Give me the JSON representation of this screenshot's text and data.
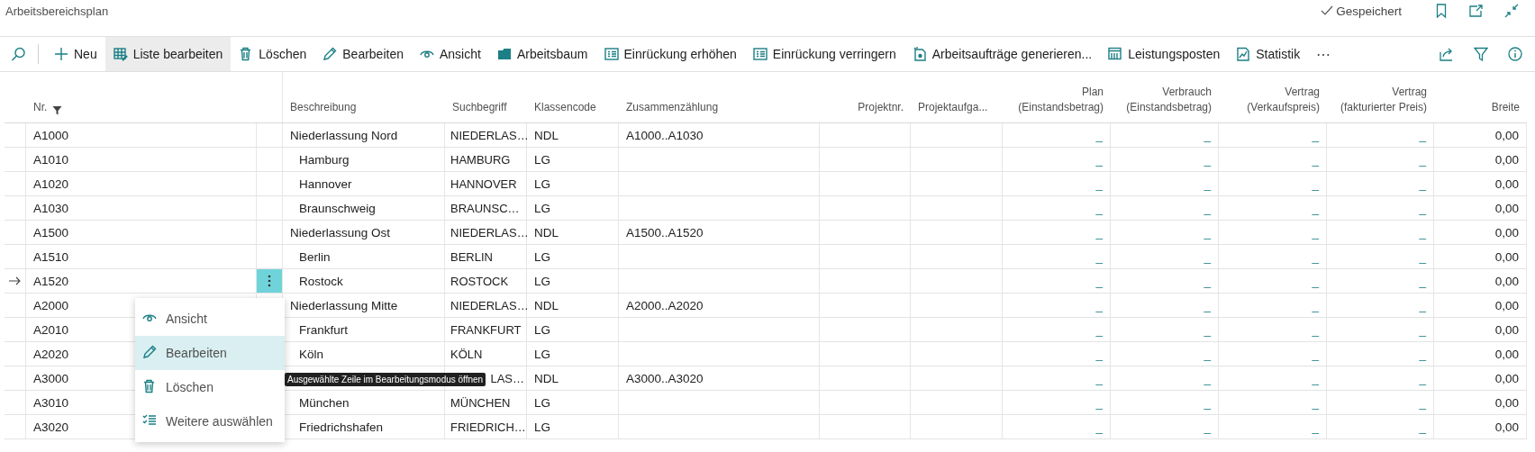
{
  "window": {
    "title": "Arbeitsbereichsplan",
    "save_status": "Gespeichert"
  },
  "toolbar": {
    "items": [
      {
        "label": "Neu",
        "selected": false
      },
      {
        "label": "Liste bearbeiten",
        "selected": true
      },
      {
        "label": "Löschen",
        "selected": false
      },
      {
        "label": "Bearbeiten",
        "selected": false
      },
      {
        "label": "Ansicht",
        "selected": false
      },
      {
        "label": "Arbeitsbaum",
        "selected": false
      },
      {
        "label": "Einrückung erhöhen",
        "selected": false
      },
      {
        "label": "Einrückung verringern",
        "selected": false
      },
      {
        "label": "Arbeitsaufträge generieren...",
        "selected": false
      },
      {
        "label": "Leistungsposten",
        "selected": false
      },
      {
        "label": "Statistik",
        "selected": false
      }
    ],
    "more": "⋯"
  },
  "table": {
    "columns": [
      {
        "label": "Nr.",
        "filtered": true
      },
      {
        "label": "Beschreibung",
        "filtered": false
      },
      {
        "label": "Suchbegriff",
        "filtered": false
      },
      {
        "label": "Klassencode",
        "filtered": false
      },
      {
        "label": "Zusammenzählung",
        "filtered": false
      },
      {
        "label": "Projektnr.",
        "filtered": false
      },
      {
        "label": "Projektaufga...",
        "filtered": false
      },
      {
        "label": "Plan\n(Einstandsbetrag)",
        "filtered": false
      },
      {
        "label": "Verbrauch\n(Einstandsbetrag)",
        "filtered": false
      },
      {
        "label": "Vertrag\n(Verkaufspreis)",
        "filtered": false
      },
      {
        "label": "Vertrag\n(fakturierter Preis)",
        "filtered": false
      },
      {
        "label": "Breite",
        "filtered": false
      }
    ],
    "rows": [
      {
        "nr": "A1000",
        "beschreibung": "Niederlassung Nord",
        "suchbegriff": "NIEDERLAS…",
        "klassencode": "NDL",
        "zusammenzaehlung": "A1000..A1030",
        "plan": "_",
        "verbrauch": "_",
        "vertrag_verkauf": "_",
        "vertrag_fakturiert": "_",
        "breite": "0,00",
        "selected": false,
        "children": [
          {
            "nr": "A1010",
            "beschreibung": "Hamburg",
            "suchbegriff": "HAMBURG",
            "klassencode": "LG",
            "plan": "_",
            "verbrauch": "_",
            "vertrag_verkauf": "_",
            "vertrag_fakturiert": "_",
            "breite": "0,00",
            "selected": false
          },
          {
            "nr": "A1020",
            "beschreibung": "Hannover",
            "suchbegriff": "HANNOVER",
            "klassencode": "LG",
            "plan": "_",
            "verbrauch": "_",
            "vertrag_verkauf": "_",
            "vertrag_fakturiert": "_",
            "breite": "0,00",
            "selected": false
          },
          {
            "nr": "A1030",
            "beschreibung": "Braunschweig",
            "suchbegriff": "BRAUNSC…",
            "klassencode": "LG",
            "plan": "_",
            "verbrauch": "_",
            "vertrag_verkauf": "_",
            "vertrag_fakturiert": "_",
            "breite": "0,00",
            "selected": false
          }
        ]
      },
      {
        "nr": "A1500",
        "beschreibung": "Niederlassung Ost",
        "suchbegriff": "NIEDERLAS…",
        "klassencode": "NDL",
        "zusammenzaehlung": "A1500..A1520",
        "plan": "_",
        "verbrauch": "_",
        "vertrag_verkauf": "_",
        "vertrag_fakturiert": "_",
        "breite": "0,00",
        "selected": false,
        "children": [
          {
            "nr": "A1510",
            "beschreibung": "Berlin",
            "suchbegriff": "BERLIN",
            "klassencode": "LG",
            "plan": "_",
            "verbrauch": "_",
            "vertrag_verkauf": "_",
            "vertrag_fakturiert": "_",
            "breite": "0,00",
            "selected": false
          },
          {
            "nr": "A1520",
            "beschreibung": "Rostock",
            "suchbegriff": "ROSTOCK",
            "klassencode": "LG",
            "plan": "_",
            "verbrauch": "_",
            "vertrag_verkauf": "_",
            "vertrag_fakturiert": "_",
            "breite": "0,00",
            "selected": true
          }
        ]
      },
      {
        "nr": "A2000",
        "beschreibung": "Niederlassung Mitte",
        "suchbegriff": "NIEDERLAS…",
        "klassencode": "NDL",
        "zusammenzaehlung": "A2000..A2020",
        "plan": "_",
        "verbrauch": "_",
        "vertrag_verkauf": "_",
        "vertrag_fakturiert": "_",
        "breite": "0,00",
        "selected": false,
        "children": [
          {
            "nr": "A2010",
            "beschreibung": "Frankfurt",
            "suchbegriff": "FRANKFURT",
            "klassencode": "LG",
            "plan": "_",
            "verbrauch": "_",
            "vertrag_verkauf": "_",
            "vertrag_fakturiert": "_",
            "breite": "0,00",
            "selected": false
          },
          {
            "nr": "A2020",
            "beschreibung": "Köln",
            "suchbegriff": "KÖLN",
            "klassencode": "LG",
            "plan": "_",
            "verbrauch": "_",
            "vertrag_verkauf": "_",
            "vertrag_fakturiert": "_",
            "breite": "0,00",
            "selected": false
          }
        ]
      },
      {
        "nr": "A3000",
        "suchbegriff": "LAS…",
        "klassencode": "NDL",
        "zusammenzaehlung": "A3000..A3020",
        "plan": "_",
        "verbrauch": "_",
        "vertrag_verkauf": "_",
        "vertrag_fakturiert": "_",
        "breite": "0,00",
        "selected": false,
        "children": [
          {
            "nr": "A3010",
            "beschreibung": "München",
            "suchbegriff": "MÜNCHEN",
            "klassencode": "LG",
            "plan": "_",
            "verbrauch": "_",
            "vertrag_verkauf": "_",
            "vertrag_fakturiert": "_",
            "breite": "0,00",
            "selected": false
          },
          {
            "nr": "A3020",
            "beschreibung": "Friedrichshafen",
            "suchbegriff": "FRIEDRICH…",
            "klassencode": "LG",
            "plan": "_",
            "verbrauch": "_",
            "vertrag_verkauf": "_",
            "vertrag_fakturiert": "_",
            "breite": "0,00",
            "selected": false
          }
        ]
      }
    ]
  },
  "context_menu": {
    "items": [
      {
        "label": "Ansicht",
        "selected": false
      },
      {
        "label": "Bearbeiten",
        "selected": true
      },
      {
        "label": "Löschen",
        "selected": false
      },
      {
        "label": "Weitere auswählen",
        "selected": false
      }
    ]
  },
  "tooltip": "Ausgewählte Zeile im Bearbeitungsmodus öffnen"
}
